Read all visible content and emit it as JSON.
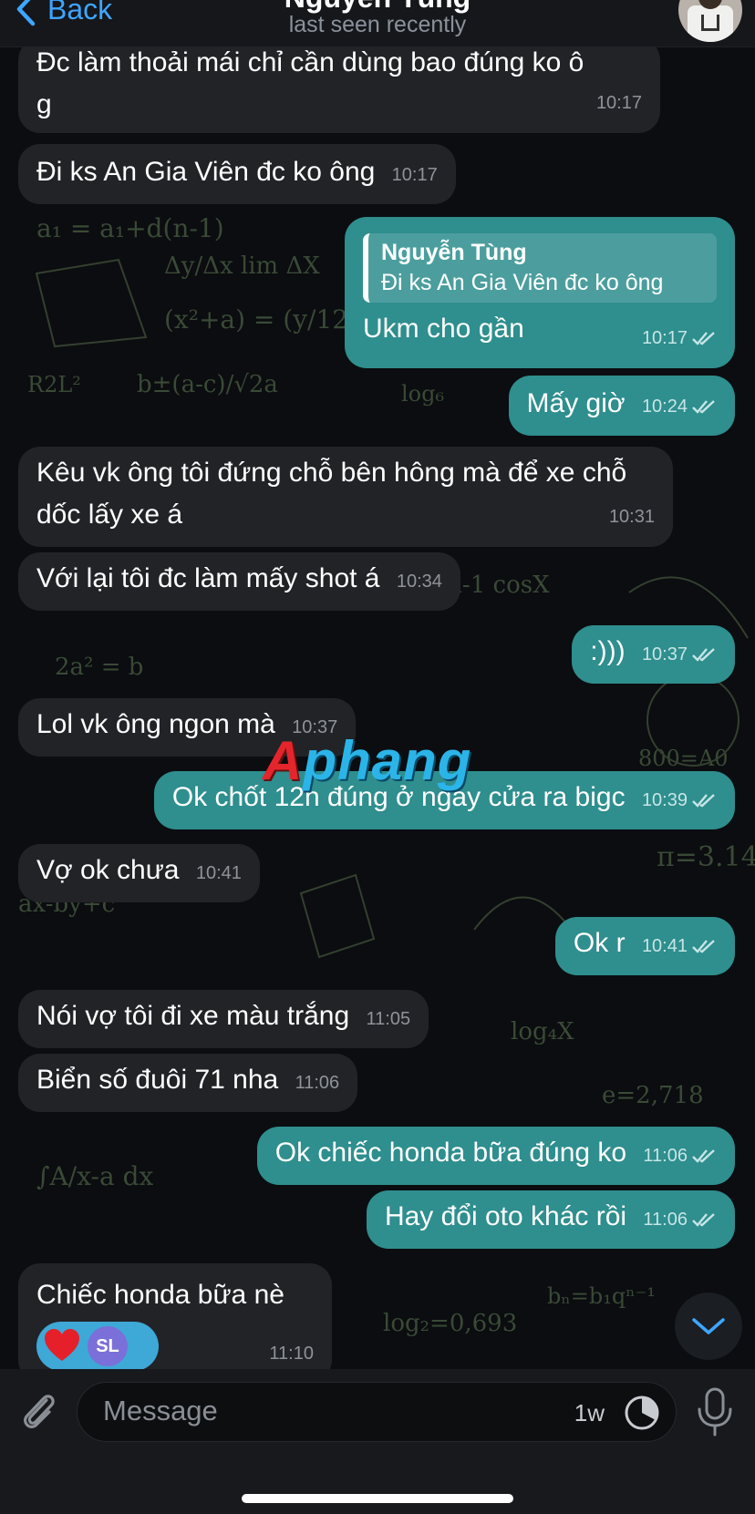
{
  "header": {
    "back_label": "Back",
    "contact_name": "Nguyễn Tùng",
    "status": "last seen recently"
  },
  "messages": [
    {
      "dir": "in",
      "text": "Đc làm thoải mái chỉ cần dùng bao đúng ko ô g",
      "time": "10:17"
    },
    {
      "dir": "in",
      "text": "Đi ks An Gia Viên đc ko ông",
      "time": "10:17"
    },
    {
      "dir": "out",
      "reply_to": {
        "name": "Nguyễn Tùng",
        "text": "Đi ks An Gia Viên đc ko ông"
      },
      "text": "Ukm cho gần",
      "time": "10:17",
      "read": true
    },
    {
      "dir": "out",
      "text": "Mấy giờ",
      "time": "10:24",
      "read": true
    },
    {
      "dir": "in",
      "text": "Kêu vk ông tôi đứng chỗ bên hông mà để xe chỗ dốc lấy xe á",
      "time": "10:31"
    },
    {
      "dir": "in",
      "text": "Với lại tôi đc làm mấy shot á",
      "time": "10:34"
    },
    {
      "dir": "out",
      "text": ":)))",
      "time": "10:37",
      "read": true
    },
    {
      "dir": "in",
      "text": "Lol vk ông ngon mà",
      "time": "10:37"
    },
    {
      "dir": "out",
      "text": "Ok chốt 12h đúng ở ngay cửa ra bigc",
      "time": "10:39",
      "read": true
    },
    {
      "dir": "in",
      "text": "Vợ ok chưa",
      "time": "10:41"
    },
    {
      "dir": "out",
      "text": "Ok r",
      "time": "10:41",
      "read": true
    },
    {
      "dir": "in",
      "text": "Nói vợ tôi đi xe màu trắng",
      "time": "11:05"
    },
    {
      "dir": "in",
      "text": "Biển số đuôi 71 nha",
      "time": "11:06"
    },
    {
      "dir": "out",
      "text": "Ok chiếc honda bữa đúng ko",
      "time": "11:06",
      "read": true
    },
    {
      "dir": "out",
      "text": "Hay đổi oto khác rồi",
      "time": "11:06",
      "read": true
    },
    {
      "dir": "in",
      "text": "Chiếc honda bữa nè",
      "time": "11:10",
      "reactions": [
        "heart",
        "SL"
      ]
    }
  ],
  "watermark": {
    "part1": "A",
    "part2": "phang"
  },
  "input": {
    "placeholder": "Message",
    "timer_label": "1w"
  },
  "colors": {
    "incoming_bubble": "#222327",
    "outgoing_bubble": "#2f8e8e",
    "accent": "#3ea6ff",
    "background": "#0b0d10"
  },
  "icons": [
    "chevron-left-icon",
    "double-check-icon",
    "heart-icon",
    "chevron-down-icon",
    "paperclip-icon",
    "timer-icon",
    "microphone-icon"
  ]
}
